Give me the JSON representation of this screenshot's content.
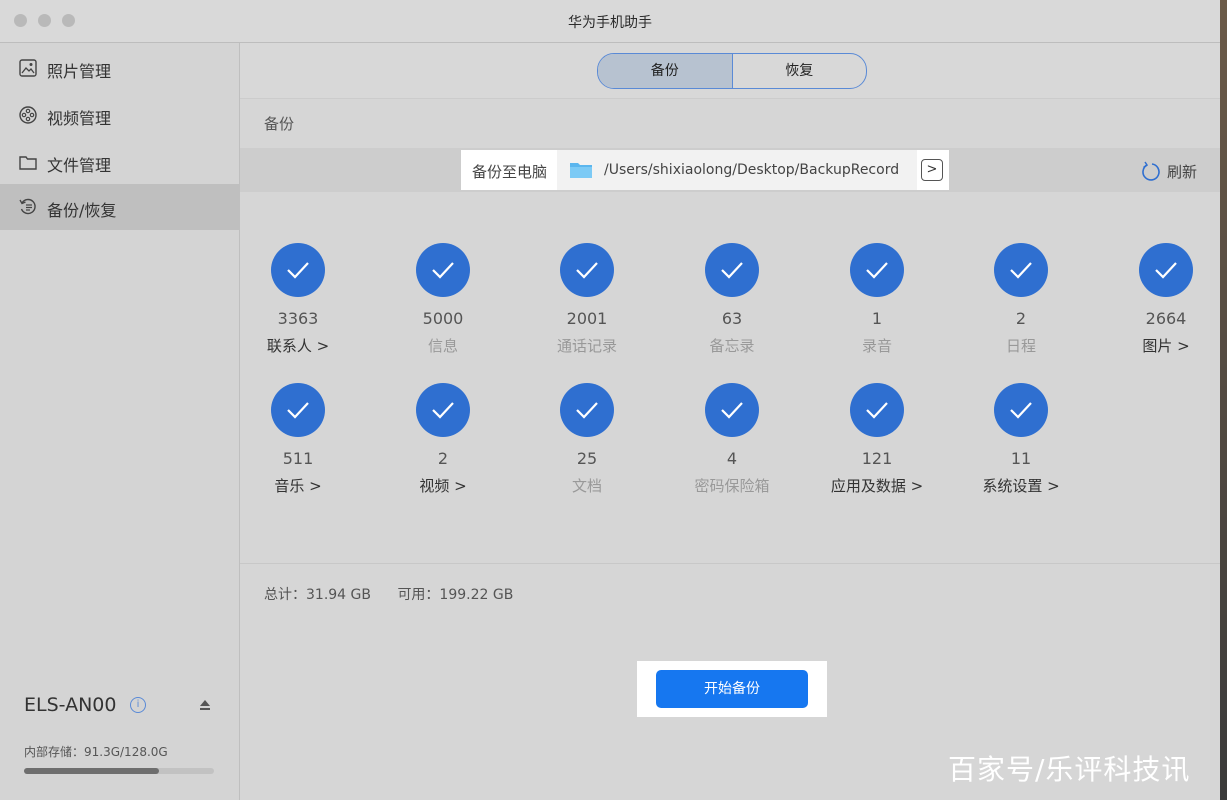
{
  "window": {
    "title": "华为手机助手"
  },
  "sidebar": {
    "items": [
      {
        "label": "照片管理",
        "icon": "photo-icon"
      },
      {
        "label": "视频管理",
        "icon": "video-reel-icon"
      },
      {
        "label": "文件管理",
        "icon": "folder-icon"
      },
      {
        "label": "备份/恢复",
        "icon": "backup-restore-icon",
        "active": true
      }
    ],
    "device_name": "ELS-AN00",
    "info_label": "i",
    "storage_text": "内部存储：91.3G/128.0G",
    "storage_used_fraction": 0.713
  },
  "tabs": [
    {
      "label": "备份",
      "active": true
    },
    {
      "label": "恢复",
      "active": false
    }
  ],
  "section_title": "备份",
  "path_bar": {
    "label": "备份至电脑",
    "path": "/Users/shixiaolong/Desktop/BackupRecord",
    "go_label": ">",
    "refresh_label": "刷新"
  },
  "backup_items": [
    {
      "count": "3363",
      "label": "联系人 >",
      "link": true
    },
    {
      "count": "5000",
      "label": "信息",
      "link": false
    },
    {
      "count": "2001",
      "label": "通话记录",
      "link": false
    },
    {
      "count": "63",
      "label": "备忘录",
      "link": false
    },
    {
      "count": "1",
      "label": "录音",
      "link": false
    },
    {
      "count": "2",
      "label": "日程",
      "link": false
    },
    {
      "count": "2664",
      "label": "图片 >",
      "link": true
    },
    {
      "count": "511",
      "label": "音乐 >",
      "link": true
    },
    {
      "count": "2",
      "label": "视频 >",
      "link": true
    },
    {
      "count": "25",
      "label": "文档",
      "link": false
    },
    {
      "count": "4",
      "label": "密码保险箱",
      "link": false
    },
    {
      "count": "121",
      "label": "应用及数据 >",
      "link": true
    },
    {
      "count": "11",
      "label": "系统设置 >",
      "link": true
    }
  ],
  "totals": {
    "total_text": "总计：31.94 GB",
    "available_text": "可用：199.22 GB"
  },
  "start_button": "开始备份",
  "watermark": "百家号/乐评科技讯",
  "colors": {
    "accent": "#1677f0",
    "check_circle": "#2f6fd0"
  }
}
